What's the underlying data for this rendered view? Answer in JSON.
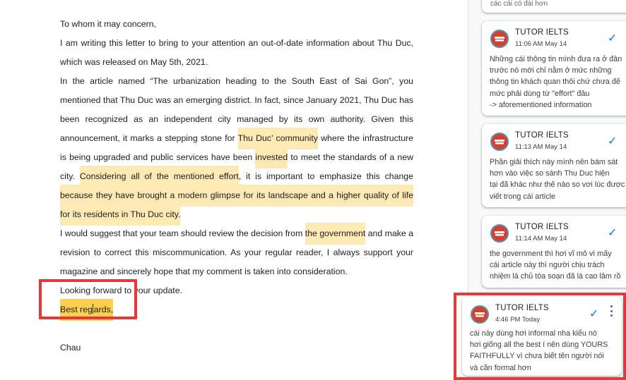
{
  "document": {
    "paragraphs": {
      "p1": "To whom it may concern,",
      "p2": "I am writing this letter to bring to your attention an out-of-date information about Thu Duc, which was released on May 5th, 2021.",
      "p3": {
        "a": "In the article named “The urbanization heading to the South East of Sai Gon”, you mentioned that Thu Duc was an emerging district. In fact, since January 2021, Thu Duc has been recognized as an independent city managed by its own authority. Given this announcement, it marks a stepping stone for ",
        "h1": "Thu Duc’ community",
        "b": " where the infrastructure is being upgraded and public services have been ",
        "h2": "invested",
        "c": " to meet the standards of a new city. ",
        "h3": "Considering all of the mentioned effort",
        "d": ", it is important to emphasize this change ",
        "h4": "because they have brought a modern glimpse for its landscape and a higher quality of life for its residents in Thu Duc city."
      },
      "p4": {
        "a": "I would suggest that your team should review the decision from ",
        "h1": "the government",
        "b": " and make a revision to correct this miscommunication. As your regular reader, I always support your magazine and sincerely hope that my comment is taken into consideration."
      },
      "p5": "Looking forward to your update.",
      "p6": {
        "before_cursor": "Best reg",
        "after_cursor": "ards,"
      },
      "p7": "Chau"
    }
  },
  "comments_sidebar": {
    "partial_top": "các cái có đài hơn",
    "comments": [
      {
        "author": "TUTOR IELTS",
        "time": "11:06 AM May 14",
        "text": "Những cái thông tin mình đưa ra ở đân\ntrước nó mới chỉ nằm ở mức những\nthông tin khách quan thôi chứ chưa đế\nmức phải dùng từ \"effort\" đâu\n-> aforementioned information"
      },
      {
        "author": "TUTOR IELTS",
        "time": "11:13 AM May 14",
        "text": "Phần giải thích này mình nên bám sát\nhơn vào việc so sánh Thu Duc hiện\ntại đã khác như thế nào so vơi lúc được\nviết trong cái article"
      },
      {
        "author": "TUTOR IELTS",
        "time": "11:14 AM May 14",
        "text": "the government thì hơi vĩ mô vì mấy\ncái article này thì người chịu trách\nnhiệm là chủ tòa soạn đã là cao lâm rồ"
      },
      {
        "author": "TUTOR IELTS",
        "time": "4:46 PM Today",
        "text": "cái này dùng hơi informal nha kiểu nó\nhơi giống all the best í nên dùng YOURS\nFAITHFULLY vì chưa biết tên người nói\nvà cần formal hơn"
      }
    ]
  },
  "colors": {
    "highlight": "#fde9b3",
    "highlight_active": "#fbd04f",
    "annotation_red": "#e53935",
    "resolve_blue": "#1a73e8"
  },
  "icons": {
    "avatar": "ielts-tutor-logo-icon",
    "resolve": "check-icon",
    "more": "more-vert-icon"
  }
}
